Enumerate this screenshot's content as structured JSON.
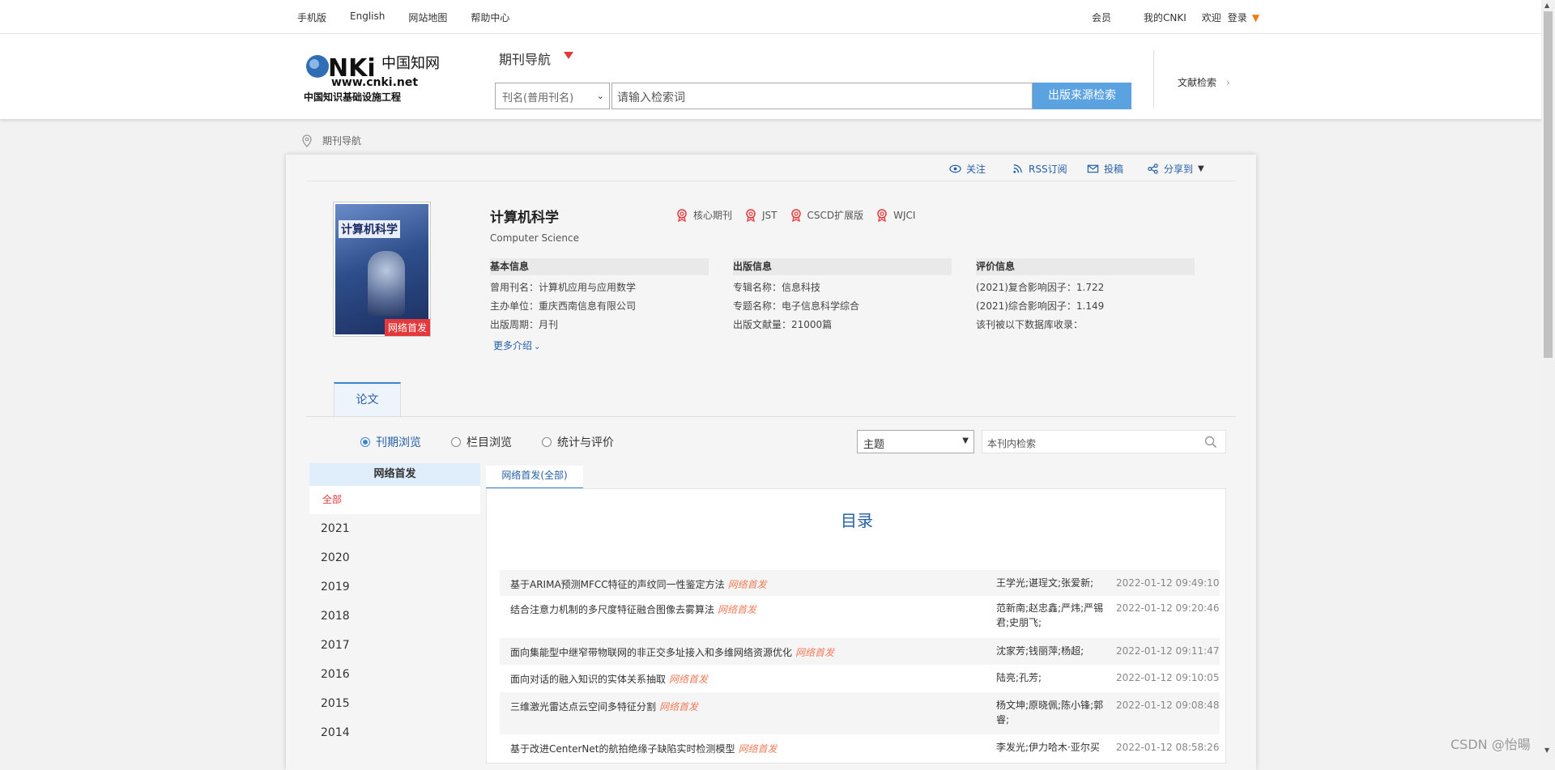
{
  "topbar": {
    "left": [
      "手机版",
      "English",
      "网站地图",
      "帮助中心"
    ],
    "member": "会员",
    "my_cnki": "我的CNKI",
    "welcome": "欢迎",
    "login": "登录"
  },
  "header": {
    "nav_title": "期刊导航",
    "search_field": "刊名(普用刊名)",
    "search_placeholder": "请输入检索词",
    "search_button": "出版来源检索",
    "literature_search": "文献检索"
  },
  "breadcrumb": "期刊导航",
  "actions": [
    "关注",
    "RSS订阅",
    "投稿",
    "分享到"
  ],
  "journal": {
    "cover_title": "计算机科学",
    "cover_badge": "网络首发",
    "title": "计算机科学",
    "subtitle": "Computer Science",
    "tags": [
      "核心期刊",
      "JST",
      "CSCD扩展版",
      "WJCI"
    ],
    "basic": {
      "header": "基本信息",
      "rows": [
        "曾用刊名：计算机应用与应用数学",
        "主办单位：重庆西南信息有限公司",
        "出版周期：月刊"
      ]
    },
    "publish": {
      "header": "出版信息",
      "rows": [
        "专辑名称：信息科技",
        "专题名称：电子信息科学综合",
        "出版文献量：21000篇"
      ]
    },
    "eval": {
      "header": "评价信息",
      "rows": [
        "(2021)复合影响因子：1.722",
        "(2021)综合影响因子：1.149",
        "该刊被以下数据库收录："
      ]
    },
    "more": "更多介绍"
  },
  "tabs": {
    "paper": "论文"
  },
  "browse": {
    "options": [
      "刊期浏览",
      "栏目浏览",
      "统计与评价"
    ],
    "selected": "刊期浏览",
    "field": "主题",
    "inner_search_placeholder": "本刊内检索"
  },
  "left_panel": {
    "header": "网络首发",
    "all": "全部",
    "years": [
      "2021",
      "2020",
      "2019",
      "2018",
      "2017",
      "2016",
      "2015",
      "2014"
    ]
  },
  "list": {
    "tab": "网络首发(全部)",
    "heading": "目录",
    "tag": "网络首发",
    "articles": [
      {
        "title": "基于ARIMA预测MFCC特征的声纹同一性鉴定方法",
        "authors": "王学光;谌珵文;张爱新;",
        "date": "2022-01-12 09:49:10"
      },
      {
        "title": "结合注意力机制的多尺度特征融合图像去雾算法",
        "authors": "范新南;赵忠鑫;严炜;严锡君;史朋飞;",
        "date": "2022-01-12 09:20:46"
      },
      {
        "title": "面向集能型中继窄带物联网的非正交多址接入和多维网络资源优化",
        "authors": "沈家芳;钱丽萍;杨超;",
        "date": "2022-01-12 09:11:47"
      },
      {
        "title": "面向对话的融入知识的实体关系抽取",
        "authors": "陆亮;孔芳;",
        "date": "2022-01-12 09:10:05"
      },
      {
        "title": "三维激光雷达点云空间多特征分割",
        "authors": "杨文坤;原晓佩;陈小锋;郭睿;",
        "date": "2022-01-12 09:08:48"
      },
      {
        "title": "基于改进CenterNet的航拍绝缘子缺陷实时检测模型",
        "authors": "李发光;伊力哈木·亚尔买",
        "date": "2022-01-12 08:58:26"
      }
    ]
  },
  "watermark": "CSDN @怡暘",
  "colors": {
    "accent": "#3b84d0",
    "link": "#245fa8",
    "red": "#e4393c",
    "orange": "#f07d10"
  }
}
